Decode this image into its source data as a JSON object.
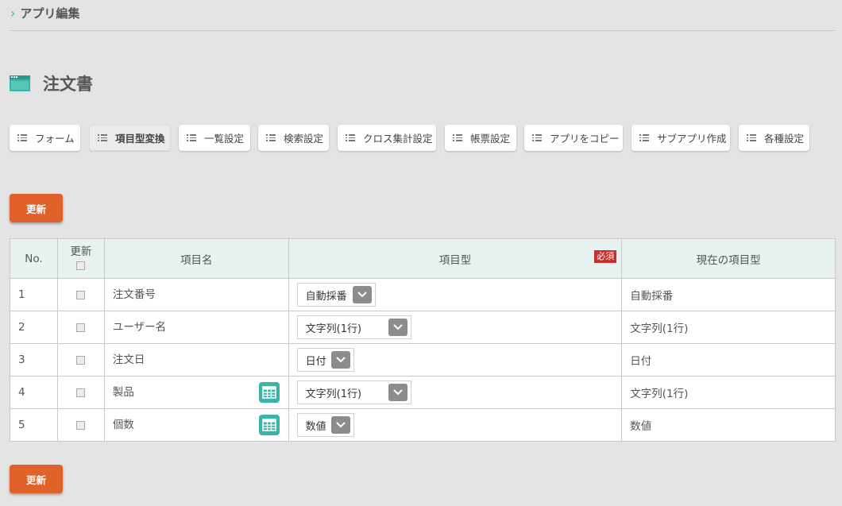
{
  "breadcrumb": {
    "label": "アプリ編集"
  },
  "page": {
    "title": "注文書"
  },
  "tabs": [
    {
      "label": "フォーム",
      "active": false
    },
    {
      "label": "項目型変換",
      "active": true
    },
    {
      "label": "一覧設定",
      "active": false
    },
    {
      "label": "検索設定",
      "active": false
    },
    {
      "label": "クロス集計設定",
      "active": false
    },
    {
      "label": "帳票設定",
      "active": false
    },
    {
      "label": "アプリをコピー",
      "active": false
    },
    {
      "label": "サブアプリ作成",
      "active": false
    },
    {
      "label": "各種設定",
      "active": false
    }
  ],
  "actions": {
    "update_top": "更新",
    "update_bottom": "更新"
  },
  "table": {
    "headers": {
      "no": "No.",
      "update": "更新",
      "name": "項目名",
      "type": "項目型",
      "required": "必須",
      "current": "現在の項目型"
    },
    "rows": [
      {
        "no": "1",
        "name": "注文番号",
        "type": "自動採番",
        "current": "自動採番",
        "checked": false,
        "table_icon": false
      },
      {
        "no": "2",
        "name": "ユーザー名",
        "type": "文字列(1行)",
        "current": "文字列(1行)",
        "checked": false,
        "table_icon": false
      },
      {
        "no": "3",
        "name": "注文日",
        "type": "日付",
        "current": "日付",
        "checked": false,
        "table_icon": false
      },
      {
        "no": "4",
        "name": "製品",
        "type": "文字列(1行)",
        "current": "文字列(1行)",
        "checked": false,
        "table_icon": true
      },
      {
        "no": "5",
        "name": "個数",
        "type": "数値",
        "current": "数値",
        "checked": false,
        "table_icon": true
      }
    ]
  },
  "colors": {
    "accent": "#3bb3a9",
    "primary_button": "#e0622a",
    "required_badge": "#c9302c",
    "header_bg": "#e8f3f1"
  }
}
